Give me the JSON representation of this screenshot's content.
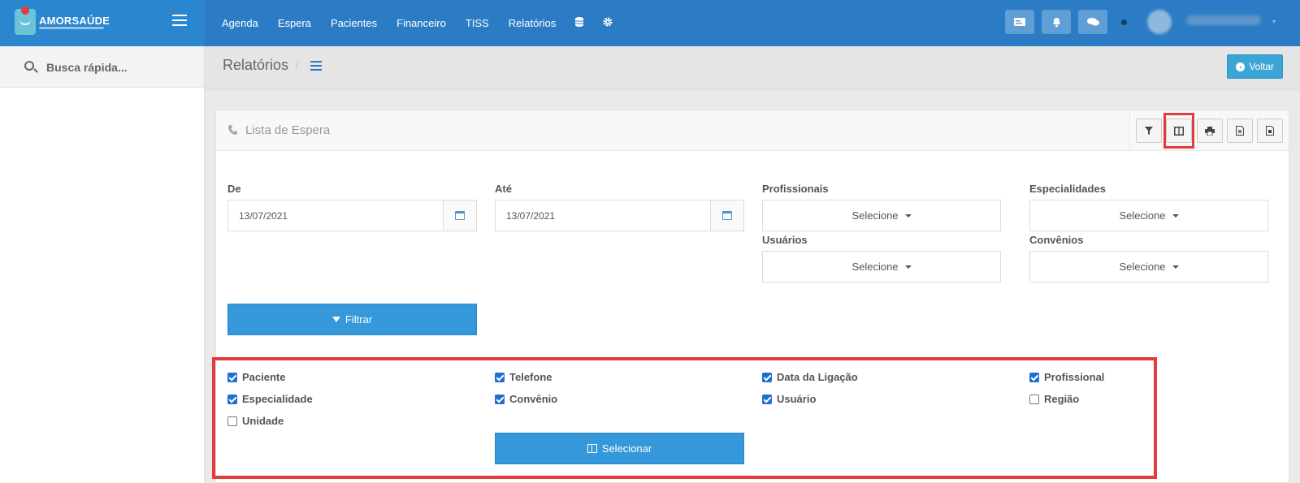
{
  "brand": {
    "name": "AMORSAÚDE"
  },
  "nav": {
    "items": [
      "Agenda",
      "Espera",
      "Pacientes",
      "Financeiro",
      "TISS",
      "Relatórios"
    ],
    "icons": [
      "database-icon",
      "gear-icon"
    ]
  },
  "topbar": {
    "icons": [
      "card-icon",
      "bell-icon",
      "chat-icon"
    ]
  },
  "sidebar": {
    "search_placeholder": "Busca rápida..."
  },
  "header": {
    "title": "Relatórios",
    "separator": "/",
    "back_label": "Voltar"
  },
  "panel": {
    "title": "Lista de Espera",
    "tools": [
      "filter-icon",
      "columns-icon",
      "print-icon",
      "excel-icon",
      "pdf-icon"
    ]
  },
  "filters": {
    "de_label": "De",
    "de_value": "13/07/2021",
    "ate_label": "Até",
    "ate_value": "13/07/2021",
    "profissionais_label": "Profissionais",
    "especialidades_label": "Especialidades",
    "usuarios_label": "Usuários",
    "convenios_label": "Convênios",
    "select_placeholder": "Selecione",
    "filter_button": "Filtrar"
  },
  "columns": {
    "items": [
      {
        "label": "Paciente",
        "checked": true
      },
      {
        "label": "Telefone",
        "checked": true
      },
      {
        "label": "Data da Ligação",
        "checked": true
      },
      {
        "label": "Profissional",
        "checked": true
      },
      {
        "label": "Especialidade",
        "checked": true
      },
      {
        "label": "Convênio",
        "checked": true
      },
      {
        "label": "Usuário",
        "checked": true
      },
      {
        "label": "Região",
        "checked": false
      },
      {
        "label": "Unidade",
        "checked": false
      }
    ],
    "select_button": "Selecionar"
  },
  "colors": {
    "topbar": "#2b7cc4",
    "primary": "#3498db",
    "highlight": "#e33b3b"
  }
}
